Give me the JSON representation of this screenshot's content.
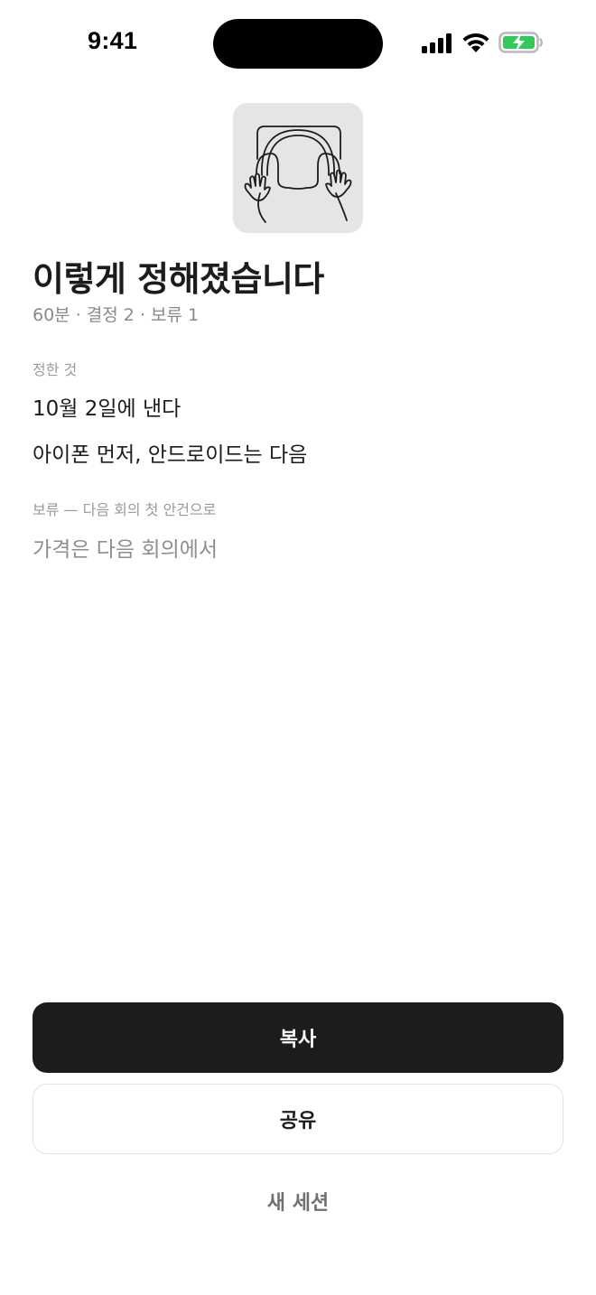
{
  "status_bar": {
    "time": "9:41"
  },
  "summary": {
    "title": "이렇게 정해졌습니다",
    "meta": "60분 · 결정 2 · 보류 1"
  },
  "decided": {
    "label": "정한 것",
    "items": [
      "10월 2일에 낸다",
      "아이폰 먼저, 안드로이드는 다음"
    ]
  },
  "pending": {
    "label": "보류 — 다음 회의 첫 안건으로",
    "items": [
      "가격은 다음 회의에서"
    ]
  },
  "actions": {
    "copy_label": "복사",
    "share_label": "공유",
    "new_session_label": "새 세션"
  },
  "colors": {
    "primary_button": "#1c1c1e",
    "battery_fill": "#34c759",
    "logo_bg": "#e6e5e3"
  }
}
